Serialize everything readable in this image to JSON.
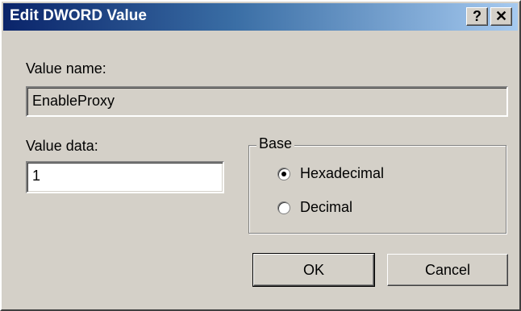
{
  "window": {
    "title": "Edit DWORD Value",
    "help_button": "?",
    "close_button": "✕"
  },
  "value_name": {
    "label": "Value name:",
    "value": "EnableProxy"
  },
  "value_data": {
    "label": "Value data:",
    "value": "1"
  },
  "base": {
    "legend": "Base",
    "options": [
      {
        "label": "Hexadecimal",
        "selected": true
      },
      {
        "label": "Decimal",
        "selected": false
      }
    ]
  },
  "buttons": {
    "ok": "OK",
    "cancel": "Cancel"
  }
}
